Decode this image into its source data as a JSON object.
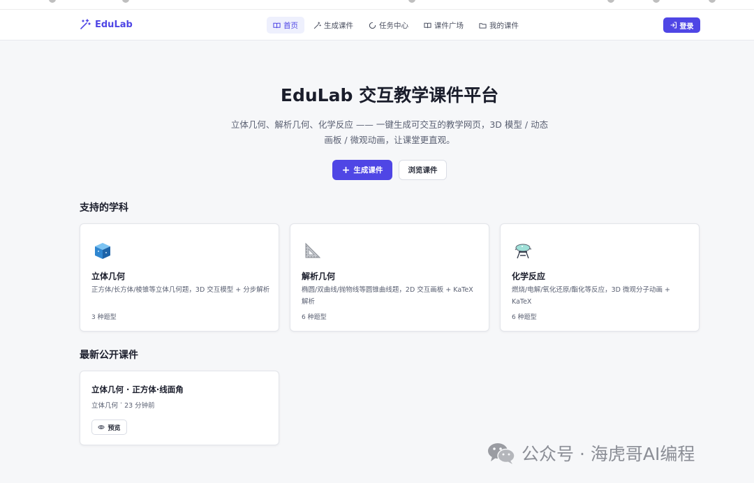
{
  "brand": {
    "name": "EduLab",
    "accent": "#4f46e5"
  },
  "nav": {
    "items": [
      {
        "label": "首页",
        "icon": "book-open-icon",
        "active": true
      },
      {
        "label": "生成课件",
        "icon": "magic-wand-icon",
        "active": false
      },
      {
        "label": "任务中心",
        "icon": "loader-icon",
        "active": false
      },
      {
        "label": "课件广场",
        "icon": "book-icon",
        "active": false
      },
      {
        "label": "我的课件",
        "icon": "folder-icon",
        "active": false
      }
    ],
    "login_label": "登录"
  },
  "hero": {
    "title": "EduLab 交互教学课件平台",
    "subtitle": "立体几何、解析几何、化学反应 —— 一键生成可交互的教学网页，3D 模型 / 动态画板 / 微观动画，让课堂更直观。",
    "primary_button": "生成课件",
    "secondary_button": "浏览课件"
  },
  "subjects": {
    "title": "支持的学科",
    "items": [
      {
        "name": "立体几何",
        "icon": "cube-icon",
        "description": "正方体/长方体/棱锥等立体几何题，3D 交互模型 + 分步解析",
        "count": "3 种题型"
      },
      {
        "name": "解析几何",
        "icon": "triangle-ruler-icon",
        "description": "椭圆/双曲线/抛物线等圆锥曲线题，2D 交互画板 + KaTeX 解析",
        "count": "6 种题型"
      },
      {
        "name": "化学反应",
        "icon": "alembic-icon",
        "description": "燃烧/电解/氧化还原/酯化等反应，3D 微观分子动画 + KaTeX",
        "count": "6 种题型"
      }
    ]
  },
  "latest": {
    "title": "最新公开课件",
    "courses": [
      {
        "title": "立体几何 · 正方体·线面角",
        "subject": "立体几何",
        "separator": " · ",
        "time": "23 分钟前",
        "preview_label": "预览"
      }
    ]
  },
  "watermark": {
    "text": "公众号 · 海虎哥AI编程"
  }
}
